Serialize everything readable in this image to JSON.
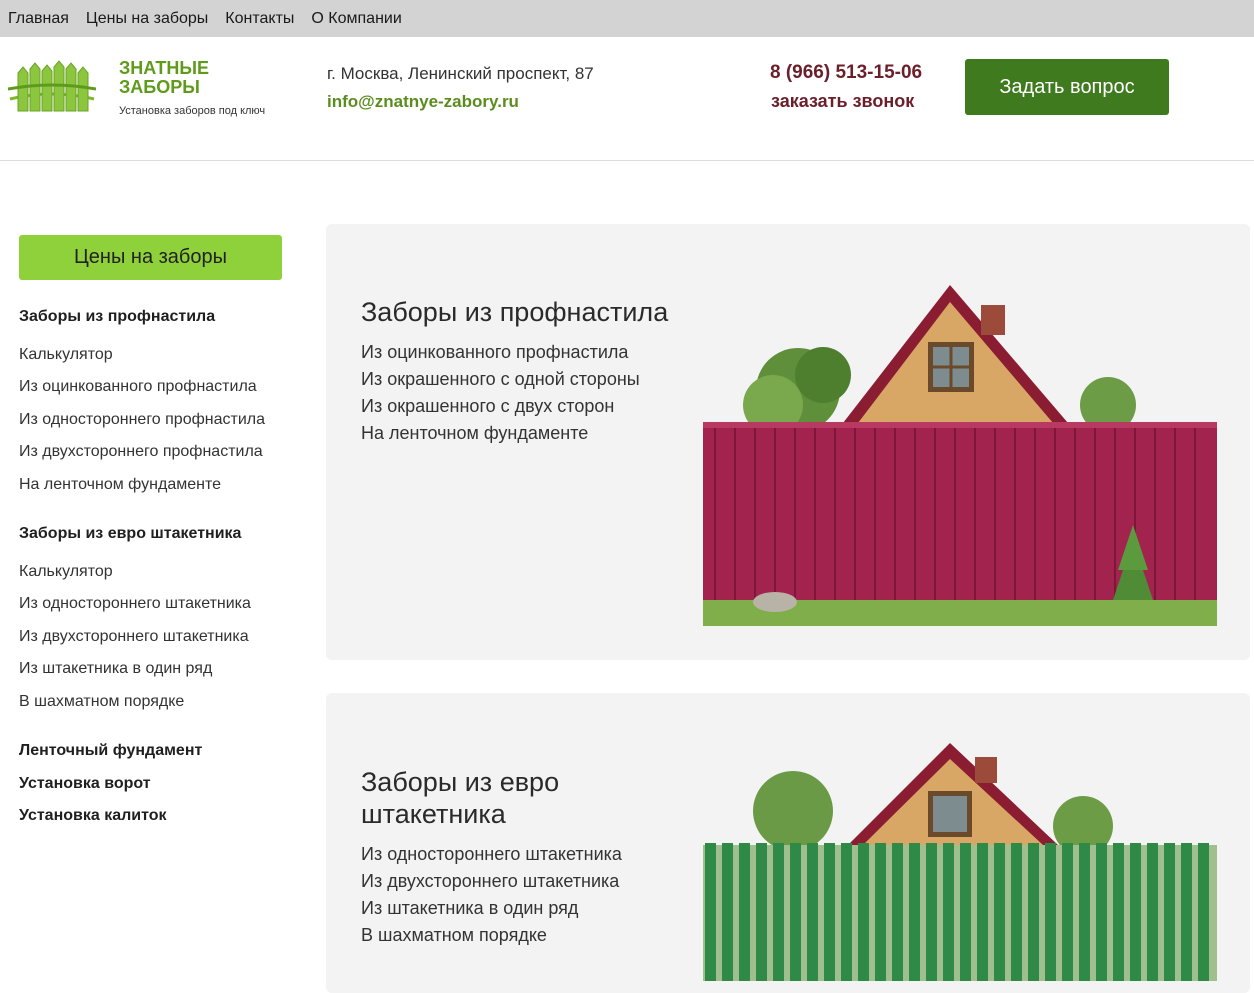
{
  "topnav": {
    "items": [
      "Главная",
      "Цены на заборы",
      "Контакты",
      "О Компании"
    ]
  },
  "header": {
    "logo_title_line1": "ЗНАТНЫЕ",
    "logo_title_line2": "ЗАБОРЫ",
    "logo_tagline": "Установка заборов под ключ",
    "address": "г. Москва, Ленинский проспект, 87",
    "email": "info@znatnye-zabory.ru",
    "phone": "8 (966) 513-15-06",
    "callback": "заказать звонок",
    "ask_button": "Задать вопрос"
  },
  "sidebar": {
    "prices_button": "Цены на заборы",
    "sections": [
      {
        "heading": "Заборы из профнастила",
        "items": [
          "Калькулятор",
          "Из оцинкованного профнастила",
          "Из одностороннего профнастила",
          "Из двухстороннего профнастила",
          "На ленточном фундаменте"
        ]
      },
      {
        "heading": "Заборы из евро штакетника",
        "items": [
          "Калькулятор",
          "Из одностороннего штакетника",
          "Из двухстороннего штакетника",
          "Из штакетника в один ряд",
          "В шахматном порядке"
        ]
      }
    ],
    "extra_links": [
      "Ленточный фундамент",
      "Установка ворот",
      "Установка калиток"
    ]
  },
  "cards": [
    {
      "title": "Заборы из профнастила",
      "items": [
        "Из оцинкованного профнастила",
        "Из окрашенного с одной стороны",
        "Из окрашенного с двух сторон",
        "На ленточном фундаменте"
      ]
    },
    {
      "title_line1": "Заборы из евро",
      "title_line2": "штакетника",
      "items": [
        "Из одностороннего штакетника",
        "Из двухстороннего штакетника",
        "Из штакетника в один ряд",
        "В шахматном порядке"
      ]
    }
  ],
  "colors": {
    "brand_green": "#5f9b1a",
    "button_dark_green": "#3f7a1e",
    "button_light_green": "#8fd13a",
    "phone_maroon": "#6b1f2a",
    "fence_profnastil": "#a3234f",
    "fence_shtaketnik": "#2f8a47"
  }
}
